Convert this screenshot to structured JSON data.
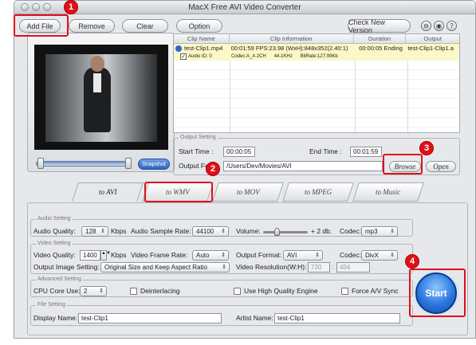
{
  "window": {
    "title": "MacX Free AVI Video Converter"
  },
  "toolbar": {
    "add_file": "Add File",
    "remove": "Remove",
    "clear": "Clear",
    "option": "Option",
    "check_version": "Check New Version",
    "icon_names": [
      "lock-icon",
      "settings-icon",
      "help-icon"
    ]
  },
  "markers": [
    "1",
    "2",
    "3",
    "4"
  ],
  "preview": {
    "snapshot": "Snapshot"
  },
  "table": {
    "headers": [
      "Clip Name",
      "Clip Information",
      "Duration",
      "Output"
    ],
    "row": {
      "name": "test-Clip1.mp4",
      "info": "00:01:59  FPS:23.98  (WxH):848x352(2.40:1)",
      "duration": "00:00:05 Ending",
      "output": "test-Clip1-Clip1.a"
    },
    "subrow": {
      "audio": "Audio ID: 0",
      "codec": "Codec:A_A 2CH",
      "hz": "44.1KHz",
      "bitrate": "BitRate:127.99Kb"
    }
  },
  "output_setting": {
    "legend": "Output Setting",
    "start_label": "Start Time :",
    "start_value": "00:00:05",
    "end_label": "End Time :",
    "end_value": "00:01:59",
    "folder_label": "Output Fo",
    "folder_value": "/Users/Dev/Movies/AVI",
    "browse": "Browse",
    "open": "Open"
  },
  "tabs": [
    "to AVI",
    "to WMV",
    "to MOV",
    "to MPEG",
    "to Music"
  ],
  "audio": {
    "legend": "Audio Setting",
    "quality_label": "Audio Quality:",
    "quality_value": "128",
    "kbps": "Kbps",
    "rate_label": "Audio Sample Rate:",
    "rate_value": "44100",
    "volume_label": "Volume:",
    "volume_suffix": "+ 2 db.",
    "codec_label": "Codec:",
    "codec_value": "mp3"
  },
  "video": {
    "legend": "Video Setting",
    "quality_label": "Video Quality:",
    "quality_value": "1400",
    "kbps": "Kbps",
    "frame_label": "Video Frame Rate:",
    "frame_value": "Auto",
    "format_label": "Output Format:",
    "format_value": "AVI",
    "codec_label": "Codec:",
    "codec_value": "DivX",
    "image_label": "Output Image Setting:",
    "image_value": "Original Size and Keep Aspect Ratio",
    "resolution_label": "Video Resolution(W:H):",
    "res_w": "720",
    "res_h": "404"
  },
  "advanced": {
    "legend": "Advanced Setting",
    "cpu_label": "CPU Core Use:",
    "cpu_value": "2",
    "deinterlacing": "Deinterlacing",
    "hq_engine": "Use High Quality Engine",
    "force_sync": "Force A/V Sync"
  },
  "file": {
    "legend": "File Setting",
    "display_label": "Display Name:",
    "display_value": "test-Clip1",
    "artist_label": "Artist Name:",
    "artist_value": "test-Clip1"
  },
  "start": {
    "label": "Start"
  }
}
